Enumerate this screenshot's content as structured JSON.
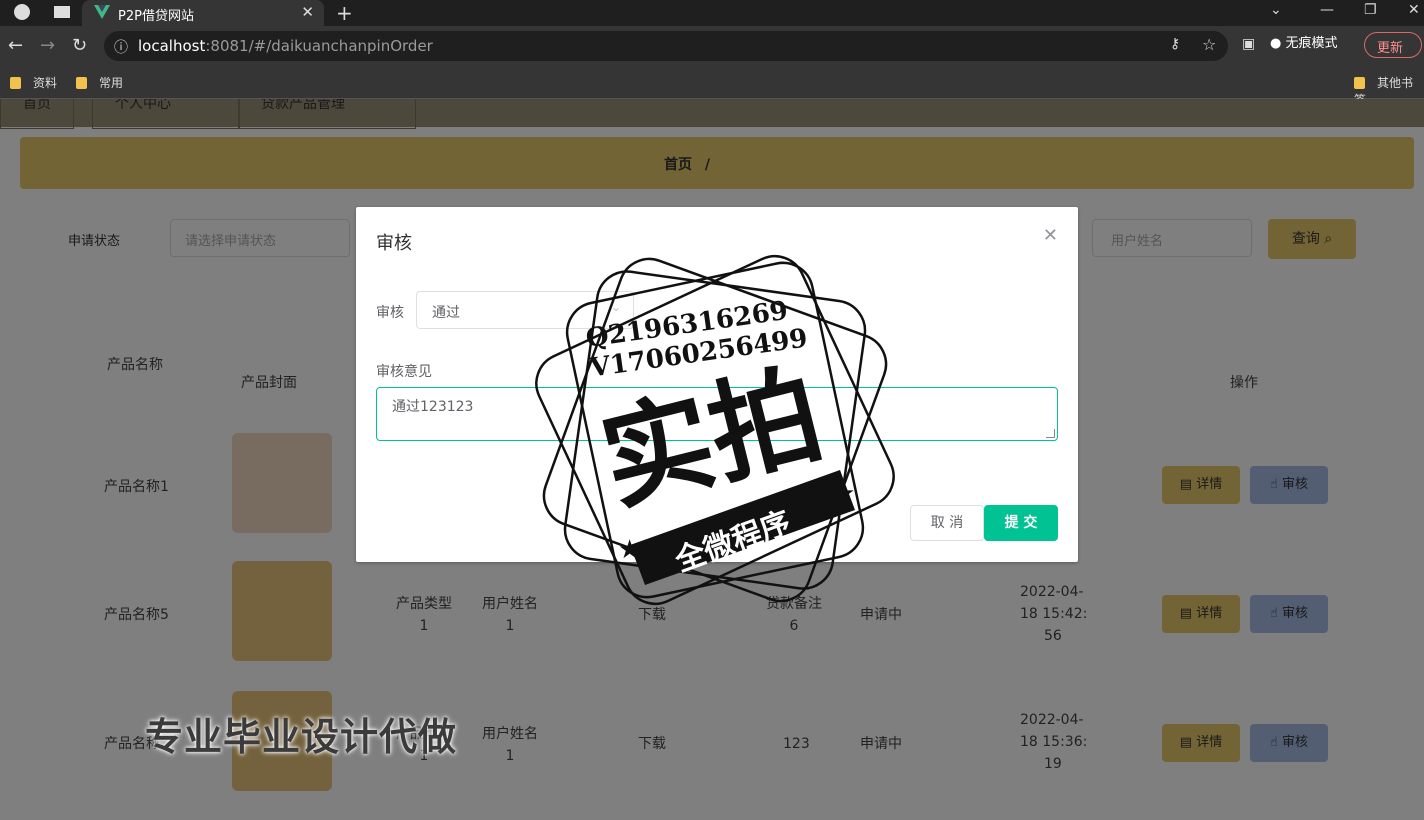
{
  "browser": {
    "tab_title": "P2P借贷网站",
    "url_host": "localhost",
    "url_rest": ":8081/#/daikuanchanpinOrder",
    "incognito_label": "无痕模式",
    "update_label": "更新",
    "bookmarks": [
      "资料",
      "常用"
    ],
    "other_bookmarks": "其他书签"
  },
  "topnav": {
    "items": [
      "首页",
      "个人中心",
      "贷款产品管理"
    ]
  },
  "breadcrumb": {
    "home": "首页",
    "separator": "/"
  },
  "search": {
    "status_label": "申请状态",
    "status_placeholder": "请选择申请状态",
    "user_placeholder": "用户姓名",
    "query_label": "查询"
  },
  "table": {
    "headers": [
      "产品名称",
      "产品封面",
      "操作"
    ],
    "rows": [
      {
        "name": "产品名称1"
      },
      {
        "name": "产品名称5",
        "type": "产品类型",
        "type_num": "1",
        "user": "用户姓名",
        "user_num": "1",
        "download": "下载",
        "remark": "贷款备注",
        "remark_num": "6",
        "status": "申请中",
        "date1": "2022-04-",
        "date2": "18 15:42:",
        "date3": "56"
      },
      {
        "name": "产品名称",
        "type": "产品类型",
        "type_num": "1",
        "user": "用户姓名",
        "user_num": "1",
        "download": "下载",
        "remark_num": "123",
        "status": "申请中",
        "date1": "2022-04-",
        "date2": "18 15:36:",
        "date3": "19"
      }
    ],
    "detail_label": "详情",
    "audit_label": "审核"
  },
  "dialog": {
    "title": "审核",
    "audit_label": "审核",
    "audit_value": "通过",
    "opinion_label": "审核意见",
    "opinion_value": "通过123123",
    "cancel_label": "取 消",
    "submit_label": "提 交"
  },
  "stamp": {
    "qq": "Q2196316269",
    "wx": "V17060256499",
    "big": "实拍",
    "ribbon": "全微程序"
  },
  "watermark": "专业毕业设计代做"
}
